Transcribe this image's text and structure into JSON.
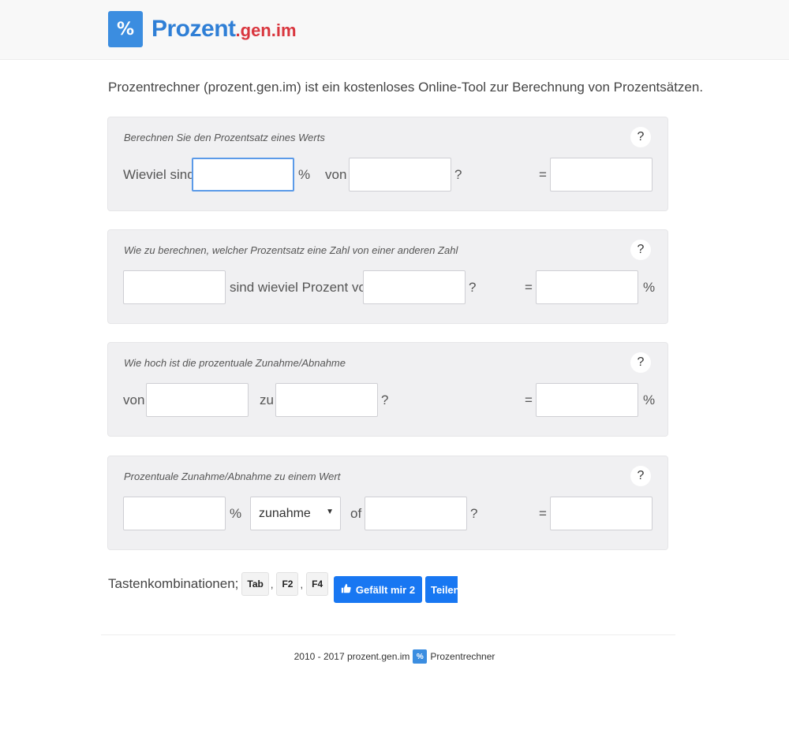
{
  "header": {
    "logo_icon": "%",
    "logo_main": "Prozent",
    "logo_sub": ".gen.im"
  },
  "intro": "Prozentrechner (prozent.gen.im) ist ein kostenloses Online-Tool zur Berechnung von Prozentsätzen.",
  "help_label": "?",
  "panels": [
    {
      "title": "Berechnen Sie den Prozentsatz eines Werts",
      "label1": "Wieviel sind",
      "label2": "%",
      "label3": "von",
      "label4": "?",
      "equals": "="
    },
    {
      "title": "Wie zu berechnen, welcher Prozentsatz eine Zahl von einer anderen Zahl",
      "label1": "sind wieviel Prozent von",
      "label2": "?",
      "equals": "=",
      "unit": "%"
    },
    {
      "title": "Wie hoch ist die prozentuale Zunahme/Abnahme",
      "label1": "von",
      "label2": "zu",
      "label3": "?",
      "equals": "=",
      "unit": "%"
    },
    {
      "title": "Prozentuale Zunahme/Abnahme zu einem Wert",
      "label1": "%",
      "select_value": "zunahme",
      "label2": "of",
      "label3": "?",
      "equals": "="
    }
  ],
  "shortcuts": {
    "label": "Tastenkombinationen;",
    "keys": [
      "Tab",
      "F2",
      "F4"
    ],
    "separator": ","
  },
  "social": {
    "like": "Gefällt mir 2",
    "share": "Teilen"
  },
  "footer": {
    "text": "2010 - 2017 prozent.gen.im",
    "badge": "%",
    "link": "Prozentrechner"
  },
  "colors": {
    "brand_blue": "#2f7fd6",
    "brand_red": "#d9363e",
    "facebook_blue": "#1877f2"
  }
}
